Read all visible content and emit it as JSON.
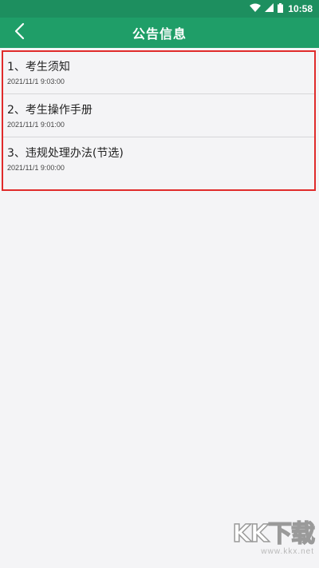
{
  "status_bar": {
    "time": "10:58",
    "icons": [
      "wifi-icon",
      "signal-icon",
      "battery-icon"
    ]
  },
  "header": {
    "title": "公告信息",
    "back_icon": "chevron-left-icon"
  },
  "announcements": [
    {
      "title": "1、考生须知",
      "date": "2021/11/1 9:03:00"
    },
    {
      "title": "2、考生操作手册",
      "date": "2021/11/1 9:01:00"
    },
    {
      "title": "3、违规处理办法(节选)",
      "date": "2021/11/1 9:00:00"
    }
  ],
  "watermark": {
    "logo": "KK下载",
    "url": "www.kkx.net"
  },
  "colors": {
    "status_bar": "#1d8f5f",
    "app_bar": "#1f9e68",
    "background": "#f4f4f6",
    "highlight_border": "#e02b2b"
  }
}
